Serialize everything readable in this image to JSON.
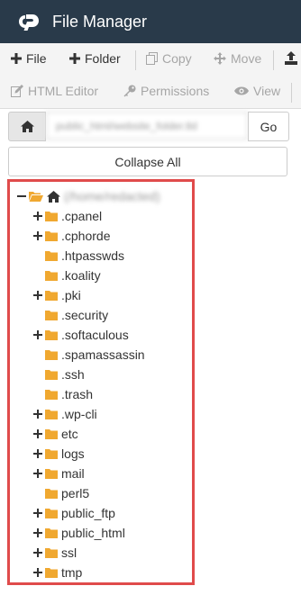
{
  "app": {
    "title": "File Manager",
    "brand_color": "#293a4a"
  },
  "toolbar": {
    "row1": [
      {
        "label": "File",
        "icon": "plus-icon",
        "state": "enabled"
      },
      {
        "label": "Folder",
        "icon": "plus-icon",
        "state": "enabled"
      },
      {
        "label": "Copy",
        "icon": "copy-icon",
        "state": "disabled"
      },
      {
        "label": "Move",
        "icon": "move-icon",
        "state": "disabled"
      },
      {
        "label": "",
        "icon": "upload-icon",
        "state": "enabled"
      }
    ],
    "row2": [
      {
        "label": "HTML Editor",
        "icon": "edit-icon",
        "state": "disabled"
      },
      {
        "label": "Permissions",
        "icon": "key-icon",
        "state": "disabled"
      },
      {
        "label": "View",
        "icon": "eye-icon",
        "state": "disabled"
      }
    ]
  },
  "path": {
    "value": "public_html/website_folder.tld",
    "go_label": "Go"
  },
  "collapse_label": "Collapse All",
  "tree": {
    "root_label": "(/home/redacted)",
    "folder_color": "#f0a830",
    "highlight_color": "#e04b4b",
    "items": [
      {
        "label": ".cpanel",
        "expandable": true
      },
      {
        "label": ".cphorde",
        "expandable": true
      },
      {
        "label": ".htpasswds",
        "expandable": false
      },
      {
        "label": ".koality",
        "expandable": false
      },
      {
        "label": ".pki",
        "expandable": true
      },
      {
        "label": ".security",
        "expandable": false
      },
      {
        "label": ".softaculous",
        "expandable": true
      },
      {
        "label": ".spamassassin",
        "expandable": false
      },
      {
        "label": ".ssh",
        "expandable": false
      },
      {
        "label": ".trash",
        "expandable": false
      },
      {
        "label": ".wp-cli",
        "expandable": true
      },
      {
        "label": "etc",
        "expandable": true
      },
      {
        "label": "logs",
        "expandable": true
      },
      {
        "label": "mail",
        "expandable": true
      },
      {
        "label": "perl5",
        "expandable": false
      },
      {
        "label": "public_ftp",
        "expandable": true
      },
      {
        "label": "public_html",
        "expandable": true
      },
      {
        "label": "ssl",
        "expandable": true
      },
      {
        "label": "tmp",
        "expandable": true
      }
    ]
  }
}
